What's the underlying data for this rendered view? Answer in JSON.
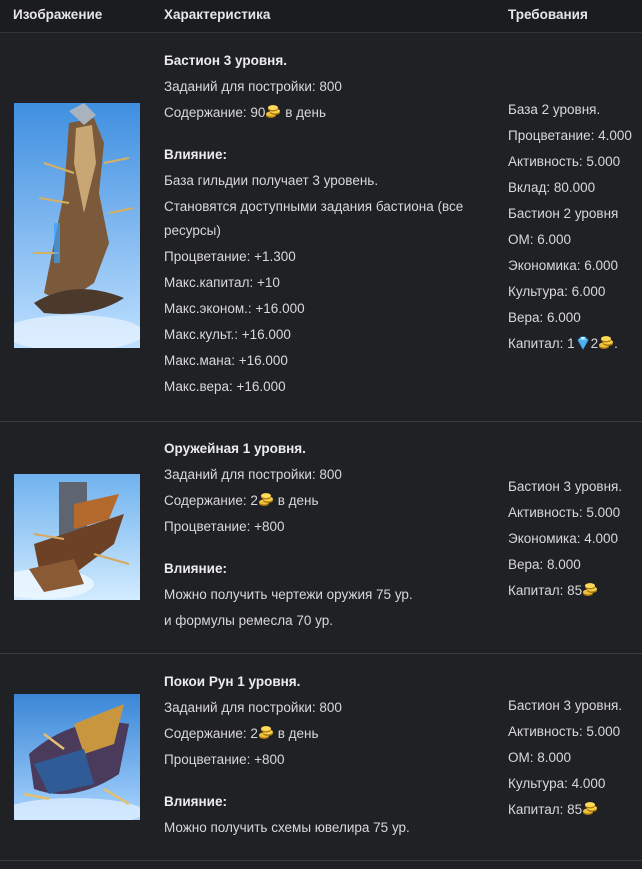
{
  "header": {
    "col_image": "Изображение",
    "col_char": "Характеристика",
    "col_req": "Требования"
  },
  "rows": [
    {
      "title": "Бастион 3 уровня.",
      "build": "Заданий для постройки: 800",
      "upkeep_prefix": "Содержание: 90",
      "upkeep_suffix": "в день",
      "influence_title": "Влияние:",
      "effects": [
        "База гильдии получает 3 уровень.",
        "Становятся доступными задания бастиона (все",
        "ресурсы)",
        "Процветание: +1.300",
        "Макс.капитал: +10",
        "Макс.эконом.: +16.000",
        "Макс.культ.: +16.000",
        "Макс.мана: +16.000",
        "Макс.вера: +16.000"
      ],
      "requirements": [
        "База 2 уровня.",
        "Процветание: 4.000",
        "Активность: 5.000",
        "Вклад: 80.000",
        "Бастион 2 уровня",
        "ОМ: 6.000",
        "Экономика: 6.000",
        "Культура: 6.000",
        "Вера: 6.000"
      ],
      "capital_prefix": "Капитал: 1",
      "capital_mid": "2",
      "capital_end": "."
    },
    {
      "title": "Оружейная 1 уровня.",
      "build": "Заданий для постройки: 800",
      "upkeep_prefix": "Содержание: 2",
      "upkeep_suffix": "в день",
      "prosperity": "Процветание: +800",
      "influence_title": "Влияние:",
      "effects": [
        "Можно получить чертежи оружия 75 ур.",
        "и формулы ремесла 70 ур."
      ],
      "requirements": [
        "Бастион 3 уровня.",
        "Активность: 5.000",
        "Экономика: 4.000",
        "Вера: 8.000"
      ],
      "capital_prefix": "Капитал: 85"
    },
    {
      "title": "Покои Рун 1 уровня.",
      "build": "Заданий для постройки: 800",
      "upkeep_prefix": "Содержание: 2",
      "upkeep_suffix": "в день",
      "prosperity": "Процветание: +800",
      "influence_title": "Влияние:",
      "effects": [
        "Можно получить схемы ювелира 75 ур."
      ],
      "requirements": [
        "Бастион 3 уровня.",
        "Активность: 5.000",
        "ОМ: 8.000",
        "Культура: 4.000"
      ],
      "capital_prefix": "Капитал: 85"
    }
  ],
  "colors": {
    "background": "#1f2124",
    "text": "#d8d8d8",
    "gold": "#e0b030",
    "gem": "#6ec8ff"
  }
}
